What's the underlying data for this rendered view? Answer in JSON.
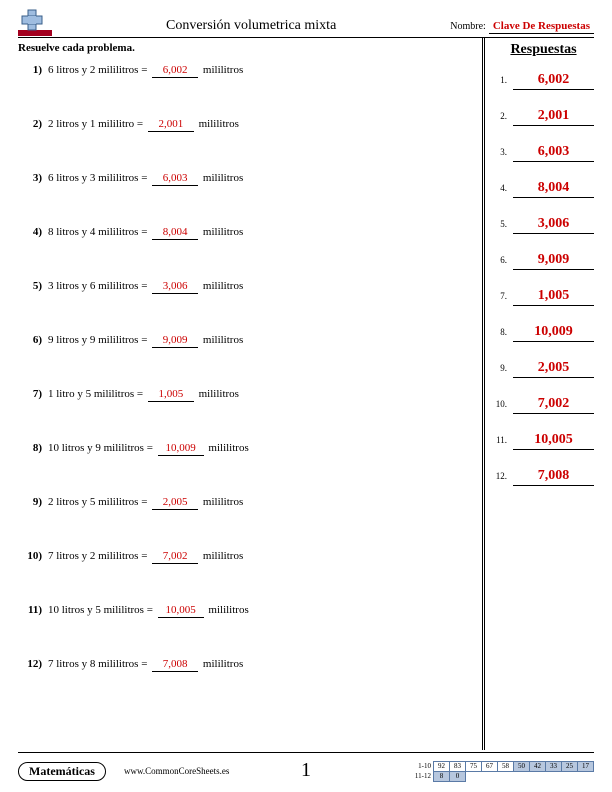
{
  "header": {
    "title": "Conversión volumetrica mixta",
    "name_label": "Nombre:",
    "name_value": "Clave De Respuestas"
  },
  "instruction": "Resuelve cada problema.",
  "problems": [
    {
      "num": "1)",
      "before": "6 litros y 2 mililitros =",
      "answer": "6,002",
      "after": "mililitros"
    },
    {
      "num": "2)",
      "before": "2 litros y 1 mililitro =",
      "answer": "2,001",
      "after": "mililitros"
    },
    {
      "num": "3)",
      "before": "6 litros y 3 mililitros =",
      "answer": "6,003",
      "after": "mililitros"
    },
    {
      "num": "4)",
      "before": "8 litros y 4 mililitros =",
      "answer": "8,004",
      "after": "mililitros"
    },
    {
      "num": "5)",
      "before": "3 litros y 6 mililitros =",
      "answer": "3,006",
      "after": "mililitros"
    },
    {
      "num": "6)",
      "before": "9 litros y 9 mililitros =",
      "answer": "9,009",
      "after": "mililitros"
    },
    {
      "num": "7)",
      "before": "1 litro y 5 mililitros =",
      "answer": "1,005",
      "after": "mililitros"
    },
    {
      "num": "8)",
      "before": "10 litros y 9 mililitros =",
      "answer": "10,009",
      "after": "mililitros"
    },
    {
      "num": "9)",
      "before": "2 litros y 5 mililitros =",
      "answer": "2,005",
      "after": "mililitros"
    },
    {
      "num": "10)",
      "before": "7 litros y 2 mililitros =",
      "answer": "7,002",
      "after": "mililitros"
    },
    {
      "num": "11)",
      "before": "10 litros y 5 mililitros =",
      "answer": "10,005",
      "after": "mililitros"
    },
    {
      "num": "12)",
      "before": "7 litros y 8 mililitros =",
      "answer": "7,008",
      "after": "mililitros"
    }
  ],
  "answers_header": "Respuestas",
  "answers": [
    {
      "n": "1.",
      "v": "6,002"
    },
    {
      "n": "2.",
      "v": "2,001"
    },
    {
      "n": "3.",
      "v": "6,003"
    },
    {
      "n": "4.",
      "v": "8,004"
    },
    {
      "n": "5.",
      "v": "3,006"
    },
    {
      "n": "6.",
      "v": "9,009"
    },
    {
      "n": "7.",
      "v": "1,005"
    },
    {
      "n": "8.",
      "v": "10,009"
    },
    {
      "n": "9.",
      "v": "2,005"
    },
    {
      "n": "10.",
      "v": "7,002"
    },
    {
      "n": "11.",
      "v": "10,005"
    },
    {
      "n": "12.",
      "v": "7,008"
    }
  ],
  "footer": {
    "subject": "Matemáticas",
    "url": "www.CommonCoreSheets.es",
    "page": "1",
    "grid": {
      "row1_label": "1-10",
      "row1": [
        "92",
        "83",
        "75",
        "67",
        "58",
        "50",
        "42",
        "33",
        "25",
        "17"
      ],
      "row2_label": "11-12",
      "row2": [
        "8",
        "0"
      ]
    }
  }
}
